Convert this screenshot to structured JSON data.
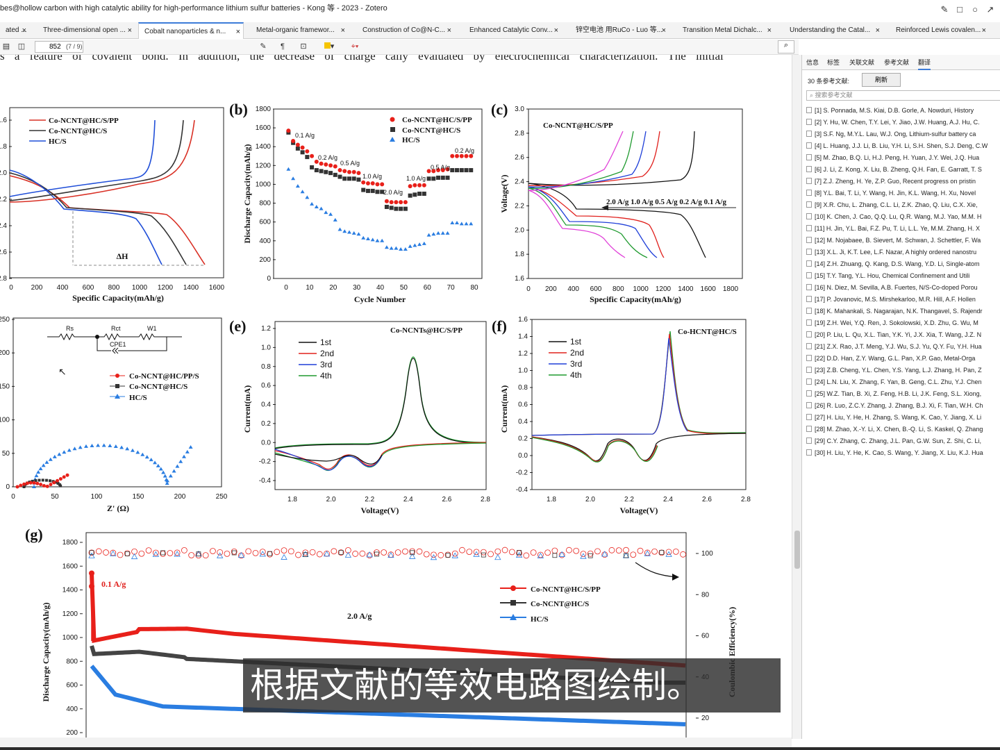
{
  "window": {
    "title": "bes@hollow carbon with high catalytic ability for high-performance lithium sulfur batteries - Kong 等 - 2023 - Zotero"
  },
  "tabs": [
    {
      "label": "ated ..."
    },
    {
      "label": "Three-dimensional open ..."
    },
    {
      "label": "Cobalt nanoparticles & n..."
    },
    {
      "label": "Metal-organic framewor..."
    },
    {
      "label": "Construction of Co@N-C..."
    },
    {
      "label": "Enhanced Catalytic Conv..."
    },
    {
      "label": "锌空电池 用RuCo - Luo 等..."
    },
    {
      "label": "Transition Metal Dichalc..."
    },
    {
      "label": "Understanding the Catal..."
    },
    {
      "label": "Reinforced Lewis covalen..."
    }
  ],
  "toolbar": {
    "page_value": "852",
    "page_count": "(7 / 9)"
  },
  "pdf": {
    "top_line": "s a feature of covalent bond. In addition, the decrease of charge    cally evaluated by electrochemical characterization. The initial"
  },
  "figures": {
    "a": {
      "ylabel": "",
      "xlabel": "Specific Capacity(mAh/g)",
      "xticks": [
        "0",
        "200",
        "400",
        "600",
        "800",
        "1000",
        "1200",
        "1400",
        "1600"
      ],
      "yticks": [
        "2.8",
        "2.6",
        "2.4",
        "2.2",
        "2.0",
        "1.8",
        "1.6"
      ],
      "legend": [
        "Co-NCNT@HC/S/PP",
        "Co-NCNT@HC/S",
        "HC/S"
      ],
      "annotation": "ΔH"
    },
    "b": {
      "panel": "(b)",
      "xlabel": "Cycle Number",
      "ylabel": "Discharge Capacity(mAh/g)",
      "xticks": [
        "0",
        "10",
        "20",
        "30",
        "40",
        "50",
        "60",
        "70",
        "80"
      ],
      "yticks": [
        "0",
        "200",
        "400",
        "600",
        "800",
        "1000",
        "1200",
        "1400",
        "1600",
        "1800"
      ],
      "legend": [
        "Co-NCNT@HC/S/PP",
        "Co-NCNT@HC/S",
        "HC/S"
      ],
      "rates": [
        "0.1 A/g",
        "0.2 A/g",
        "0.5 A/g",
        "1.0 A/g",
        "2.0 A/g",
        "1.0 A/g",
        "0.5 A/g",
        "0.2 A/g"
      ]
    },
    "c": {
      "panel": "(c)",
      "xlabel": "Specific Capacity(mAh/g)",
      "ylabel": "Voltage(V)",
      "xticks": [
        "0",
        "200",
        "400",
        "600",
        "800",
        "1000",
        "1200",
        "1400",
        "1600",
        "1800"
      ],
      "yticks": [
        "1.6",
        "1.8",
        "2.0",
        "2.2",
        "2.4",
        "2.6",
        "2.8",
        "3.0"
      ],
      "sample": "Co-NCNT@HC/S/PP",
      "rates": "2.0 A/g 1.0 A/g 0.5 A/g 0.2 A/g 0.1 A/g"
    },
    "d": {
      "xlabel": "Z' (Ω)",
      "xticks": [
        "0",
        "50",
        "100",
        "150",
        "200",
        "250"
      ],
      "yticks": [
        "0",
        "50",
        "100",
        "150",
        "200",
        "250"
      ],
      "circuit": [
        "Rs",
        "Rct",
        "W1",
        "CPE1"
      ],
      "legend": [
        "Co-NCNT@HC/PP/S",
        "Co-NCNT@HC/S",
        "HC/S"
      ]
    },
    "e": {
      "panel": "(e)",
      "xlabel": "Voltage(V)",
      "ylabel": "Current(mA)",
      "sample": "Co-NCNTs@HC/S/PP",
      "xticks": [
        "1.8",
        "2.0",
        "2.2",
        "2.4",
        "2.6",
        "2.8"
      ],
      "yticks": [
        "-0.4",
        "-0.2",
        "0.0",
        "0.2",
        "0.4",
        "0.6",
        "0.8",
        "1.0",
        "1.2"
      ],
      "legend": [
        "1st",
        "2nd",
        "3rd",
        "4th"
      ]
    },
    "f": {
      "panel": "(f)",
      "xlabel": "Voltage(V)",
      "ylabel": "Current(mA)",
      "sample": "Co-HCNT@HC/S",
      "xticks": [
        "1.8",
        "2.0",
        "2.2",
        "2.4",
        "2.6",
        "2.8"
      ],
      "yticks": [
        "-0.4",
        "-0.2",
        "0.0",
        "0.2",
        "0.4",
        "0.6",
        "0.8",
        "1.0",
        "1.2",
        "1.4",
        "1.6"
      ],
      "legend": [
        "1st",
        "2nd",
        "3rd",
        "4th"
      ]
    },
    "g": {
      "panel": "(g)",
      "ylabel": "Discharge Capacity(mAh/g)",
      "ylabel2": "Coulombic Efficiency(%)",
      "yticks": [
        "200",
        "400",
        "600",
        "800",
        "1000",
        "1200",
        "1400",
        "1600",
        "1800"
      ],
      "y2ticks": [
        "20",
        "60",
        "80",
        "100"
      ],
      "legend": [
        "Co-NCNT@HC/S/PP",
        "Co-NCNT@HC/S",
        "HC/S"
      ],
      "rate_small": "0.1 A/g",
      "rate_main": "2.0 A/g"
    }
  },
  "subtitle": "根据文献的等效电路图绘制。",
  "pane": {
    "tabs": [
      "信息",
      "标签",
      "关联文献",
      "参考文献",
      "翻译"
    ],
    "ref_count": "30 条参考文献:",
    "refresh": "刷新",
    "search_placeholder": "搜索参考文献",
    "refs": [
      "[1] S. Ponnada, M.S. Kiai, D.B. Gorle, A. Nowduri, History",
      "[2] Y. Hu, W. Chen, T.Y. Lei, Y. Jiao, J.W. Huang, A.J. Hu, C.",
      "[3] S.F. Ng, M.Y.L. Lau, W.J. Ong, Lithium-sulfur battery ca",
      "[4] L. Huang, J.J. Li, B. Liu, Y.H. Li, S.H. Shen, S.J. Deng, C.W",
      "[5] M. Zhao, B.Q. Li, H.J. Peng, H. Yuan, J.Y. Wei, J.Q. Hua",
      "[6] J. Li, Z. Kong, X. Liu, B. Zheng, Q.H. Fan, E. Garratt, T. S",
      "[7] Z.J. Zheng, H. Ye, Z.P. Guo, Recent progress on pristin",
      "[8] Y.L. Bai, T. Li, Y. Wang, H. Jin, K.L. Wang, H. Xu, Novel",
      "[9] X.R. Chu, L. Zhang, C.L. Li, Z.K. Zhao, Q. Liu, C.X. Xie,",
      "[10] K. Chen, J. Cao, Q.Q. Lu, Q.R. Wang, M.J. Yao, M.M. H",
      "[11] H. Jin, Y.L. Bai, F.Z. Pu, T. Li, L.L. Ye, M.M. Zhang, H. X",
      "[12] M. Nojabaee, B. Sievert, M. Schwan, J. Schettler, F. Wa",
      "[13] X.L. Ji, K.T. Lee, L.F. Nazar, A highly ordered nanostru",
      "[14] Z.H. Zhuang, Q. Kang, D.S. Wang, Y.D. Li, Single-atom",
      "[15] T.Y. Tang, Y.L. Hou, Chemical Confinement and Utili",
      "[16] N. Diez, M. Sevilla, A.B. Fuertes, N/S-Co-doped Porou",
      "[17] P. Jovanovic, M.S. Mirshekarloo, M.R. Hill, A.F. Hollen",
      "[18] K. Mahankali, S. Nagarajan, N.K. Thangavel, S. Rajendr",
      "[19] Z.H. Wei, Y.Q. Ren, J. Sokolowski, X.D. Zhu, G. Wu, M",
      "[20] P. Liu, L. Qu, X.L. Tian, Y.K. Yi, J.X. Xia, T. Wang, J.Z. N",
      "[21] Z.X. Rao, J.T. Meng, Y.J. Wu, S.J. Yu, Q.Y. Fu, Y.H. Hua",
      "[22] D.D. Han, Z.Y. Wang, G.L. Pan, X.P. Gao, Metal-Orga",
      "[23] Z.B. Cheng, Y.L. Chen, Y.S. Yang, L.J. Zhang, H. Pan, Z",
      "[24] L.N. Liu, X. Zhang, F. Yan, B. Geng, C.L. Zhu, Y.J. Chen",
      "[25] W.Z. Tian, B. Xi, Z. Feng, H.B. Li, J.K. Feng, S.L. Xiong,",
      "[26] R. Luo, Z.C.Y. Zhang, J. Zhang, B.J. Xi, F. Tian, W.H. Ch",
      "[27] H. Liu, Y. He, H. Zhang, S. Wang, K. Cao, Y. Jiang, X. Li",
      "[28] M. Zhao, X.-Y. Li, X. Chen, B.-Q. Li, S. Kaskel, Q. Zhang",
      "[29] C.Y. Zhang, C. Zhang, J.L. Pan, G.W. Sun, Z. Shi, C. Li,",
      "[30] H. Liu, Y. He, K. Cao, S. Wang, Y. Jiang, X. Liu, K.J. Hua"
    ]
  }
}
